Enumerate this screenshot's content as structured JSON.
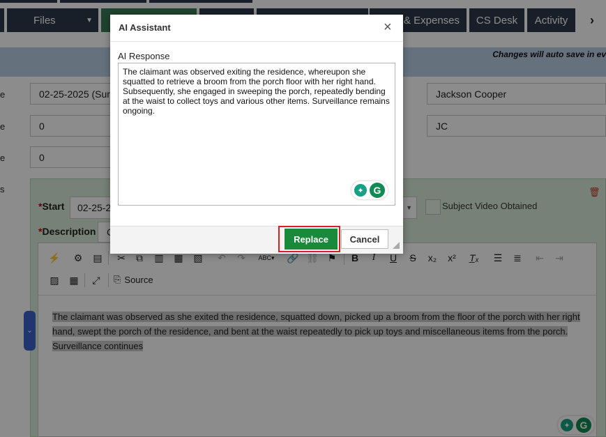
{
  "nav": {
    "tabs": [
      {
        "label": "Files"
      },
      {
        "label": "& Expenses"
      },
      {
        "label": "CS Desk"
      },
      {
        "label": "Activity"
      }
    ],
    "next_icon": "chevron-right-icon"
  },
  "banner": {
    "text": "Changes will auto save in ev"
  },
  "form": {
    "date_value": "02-25-2025 (Surv",
    "field2_value": "0",
    "field3_value": "0",
    "investigator_name": "Jackson Cooper",
    "initials": "JC",
    "labels": [
      "e",
      "e",
      "e",
      "s"
    ]
  },
  "panel": {
    "start_label": "Start",
    "start_value": "02-25-20",
    "description_label": "Description",
    "description_prefix": "C",
    "subject_video_label": "Subject Video Obtained",
    "source_label": "Source",
    "editor_text": "The claimant was observed as she exited the residence, squatted down, picked up a broom from the floor of the porch with her right hand, swept the porch of the residence, and bent at the waist repeatedly to pick up toys and miscellaneous items from the porch. Surveillance continues"
  },
  "dialog": {
    "title": "AI Assistant",
    "response_label": "AI Response",
    "response_text": "The claimant was observed exiting the residence, whereupon she squatted to retrieve a broom from the porch floor with her right hand. Subsequently, she engaged in sweeping the porch, repeatedly bending at the waist to collect toys and various other items. Surveillance remains ongoing.",
    "replace_label": "Replace",
    "cancel_label": "Cancel",
    "close_symbol": "×"
  },
  "colors": {
    "nav_dark": "#2e3a4a",
    "nav_green": "#3a7a55",
    "replace_green": "#198a3c",
    "highlight_red": "#d32020",
    "panel_green": "#d9ecd9"
  }
}
